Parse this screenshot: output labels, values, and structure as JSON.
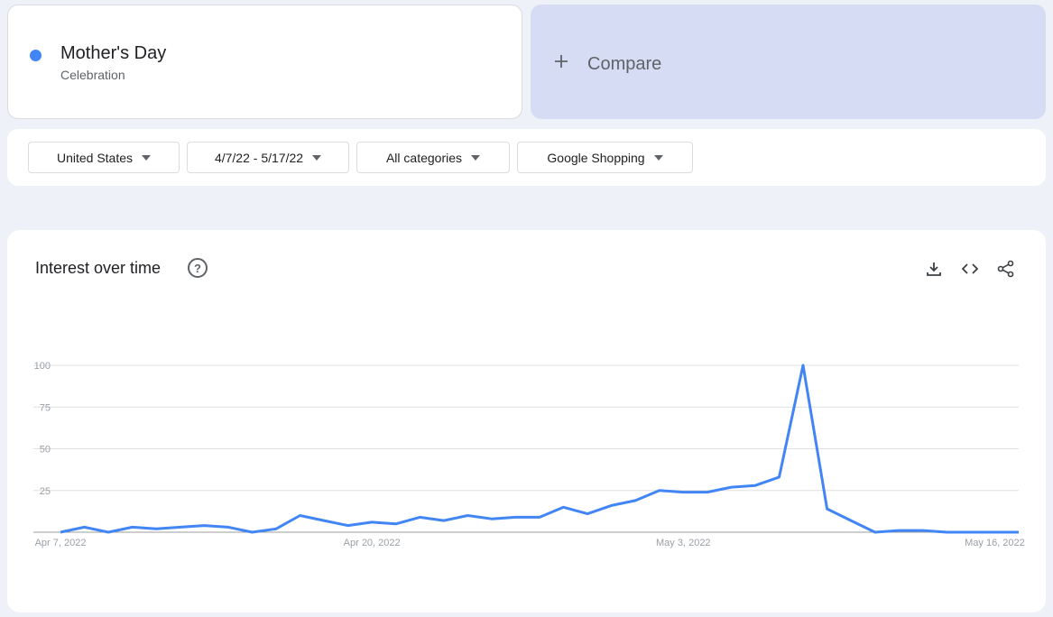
{
  "term": {
    "name": "Mother's Day",
    "type": "Celebration",
    "color": "#4285f4"
  },
  "compare": {
    "icon": "plus-icon",
    "label": "Compare"
  },
  "filters": [
    {
      "label": "United States"
    },
    {
      "label": "4/7/22 - 5/17/22"
    },
    {
      "label": "All categories"
    },
    {
      "label": "Google Shopping"
    }
  ],
  "panel": {
    "title": "Interest over time",
    "help_icon": "help-circle-icon",
    "actions": [
      "download-icon",
      "embed-code-icon",
      "share-icon"
    ]
  },
  "chart_data": {
    "type": "line",
    "series_color": "#4285f4",
    "ylim": [
      0,
      100
    ],
    "y_ticks": [
      "100",
      "75",
      "50",
      "25"
    ],
    "x_tick_labels": [
      "Apr 7, 2022",
      "Apr 20, 2022",
      "May 3, 2022",
      "May 16, 2022"
    ],
    "grid": true,
    "x": [
      "2022-04-07",
      "2022-04-08",
      "2022-04-09",
      "2022-04-10",
      "2022-04-11",
      "2022-04-12",
      "2022-04-13",
      "2022-04-14",
      "2022-04-15",
      "2022-04-16",
      "2022-04-17",
      "2022-04-18",
      "2022-04-19",
      "2022-04-20",
      "2022-04-21",
      "2022-04-22",
      "2022-04-23",
      "2022-04-24",
      "2022-04-25",
      "2022-04-26",
      "2022-04-27",
      "2022-04-28",
      "2022-04-29",
      "2022-04-30",
      "2022-05-01",
      "2022-05-02",
      "2022-05-03",
      "2022-05-04",
      "2022-05-05",
      "2022-05-06",
      "2022-05-07",
      "2022-05-08",
      "2022-05-09",
      "2022-05-10",
      "2022-05-11",
      "2022-05-12",
      "2022-05-13",
      "2022-05-14",
      "2022-05-15",
      "2022-05-16",
      "2022-05-17"
    ],
    "values": [
      0,
      3,
      0,
      3,
      2,
      3,
      4,
      3,
      0,
      2,
      10,
      7,
      4,
      6,
      5,
      9,
      7,
      10,
      8,
      9,
      9,
      15,
      11,
      16,
      19,
      25,
      24,
      24,
      27,
      28,
      33,
      100,
      14,
      7,
      0,
      1,
      1,
      0,
      0,
      0,
      0
    ]
  }
}
